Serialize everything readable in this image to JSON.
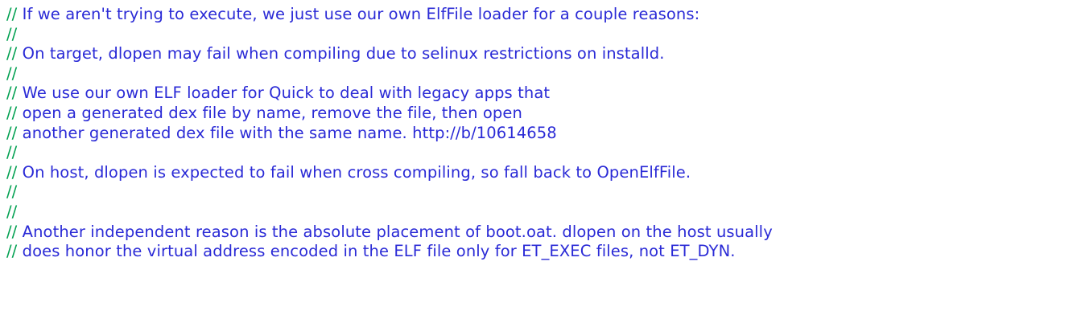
{
  "editor": {
    "comment_marker": "//",
    "marker_color": "#00a050",
    "text_color": "#2a2ad6",
    "lines": [
      " If we aren't trying to execute, we just use our own ElfFile loader for a couple reasons:",
      "",
      " On target, dlopen may fail when compiling due to selinux restrictions on installd.",
      "",
      " We use our own ELF loader for Quick to deal with legacy apps that",
      " open a generated dex file by name, remove the file, then open",
      " another generated dex file with the same name. http://b/10614658",
      "",
      " On host, dlopen is expected to fail when cross compiling, so fall back to OpenElfFile.",
      "",
      "",
      " Another independent reason is the absolute placement of boot.oat. dlopen on the host usually",
      " does honor the virtual address encoded in the ELF file only for ET_EXEC files, not ET_DYN."
    ]
  }
}
